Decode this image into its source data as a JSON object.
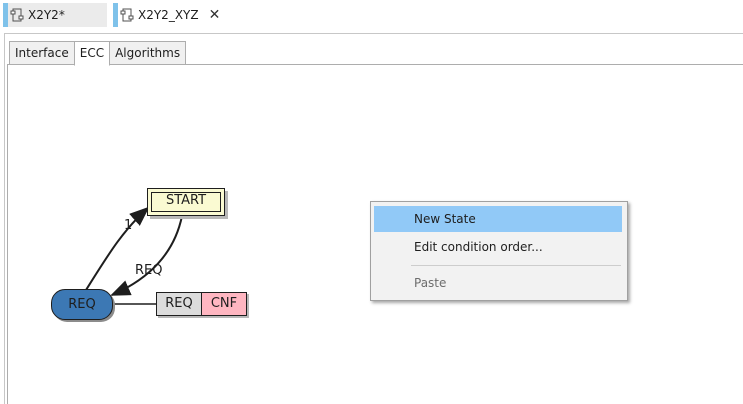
{
  "editor_tabs": [
    {
      "label": "X2Y2*",
      "active": false
    },
    {
      "label": "X2Y2_XYZ",
      "active": true
    }
  ],
  "sub_tabs": [
    "Interface",
    "ECC",
    "Algorithms"
  ],
  "active_sub_tab": "ECC",
  "ecc": {
    "start_state": "START",
    "req_state": "REQ",
    "transition_condition_1": "1",
    "transition_condition_2": "REQ",
    "action_algorithm": "REQ",
    "action_output_event": "CNF"
  },
  "context_menu": {
    "new_state": "New State",
    "edit_condition_order": "Edit condition order...",
    "paste": "Paste"
  },
  "colors": {
    "tab_accent": "#7fc2ea",
    "start_fill": "#fafad2",
    "state_fill": "#3c78b4",
    "algorithm_fill": "#dcdcdc",
    "event_fill": "#ffb6c1",
    "menu_highlight": "#91c9f7"
  }
}
